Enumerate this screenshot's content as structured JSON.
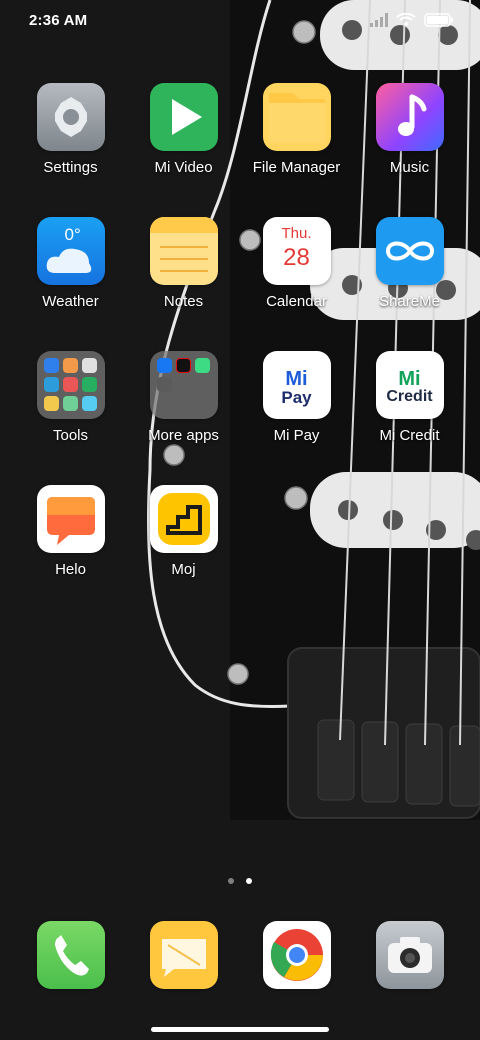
{
  "status_bar": {
    "time": "2:36 AM",
    "icons": [
      "signal-icon",
      "wifi-icon",
      "battery-icon"
    ]
  },
  "apps": [
    {
      "label": "Settings",
      "icon": "settings-icon"
    },
    {
      "label": "Mi Video",
      "icon": "mi-video-icon"
    },
    {
      "label": "File Manager",
      "icon": "file-manager-icon"
    },
    {
      "label": "Music",
      "icon": "music-icon"
    },
    {
      "label": "Weather",
      "icon": "weather-icon",
      "temp": "0°"
    },
    {
      "label": "Notes",
      "icon": "notes-icon"
    },
    {
      "label": "Calendar",
      "icon": "calendar-icon",
      "month": "Thu.",
      "day": "28"
    },
    {
      "label": "ShareMe",
      "icon": "shareme-icon"
    },
    {
      "label": "Tools",
      "icon": "tools-folder-icon"
    },
    {
      "label": "More apps",
      "icon": "more-apps-folder-icon"
    },
    {
      "label": "Mi Pay",
      "icon": "mi-pay-icon",
      "logo": "Mi",
      "sub": "Pay"
    },
    {
      "label": "Mi Credit",
      "icon": "mi-credit-icon",
      "logo": "Mi",
      "sub": "Credit"
    },
    {
      "label": "Helo",
      "icon": "helo-icon"
    },
    {
      "label": "Moj",
      "icon": "moj-icon"
    }
  ],
  "page_indicator": {
    "pages": 2,
    "active": 2
  },
  "dock": [
    {
      "name": "phone",
      "icon": "phone-icon"
    },
    {
      "name": "messages",
      "icon": "messages-icon"
    },
    {
      "name": "chrome",
      "icon": "chrome-icon"
    },
    {
      "name": "camera",
      "icon": "camera-icon"
    }
  ],
  "colors": {
    "wallpaper": "#161616",
    "settings": "#9aa0a6",
    "mi_video": "#2fb45b",
    "file_manager": "#f9c74f",
    "music": "#8e44ad",
    "weather": "#2196f3",
    "notes": "#ffd166",
    "calendar_accent": "#e53935",
    "shareme": "#1e88e5",
    "mi_pay": "#1e5bd8",
    "mi_credit": "#12a35b",
    "helo": "#ff6b3d",
    "moj": "#ffcc00",
    "phone": "#6ad055",
    "messages": "#ffc73d",
    "camera": "#9aa0a6"
  }
}
